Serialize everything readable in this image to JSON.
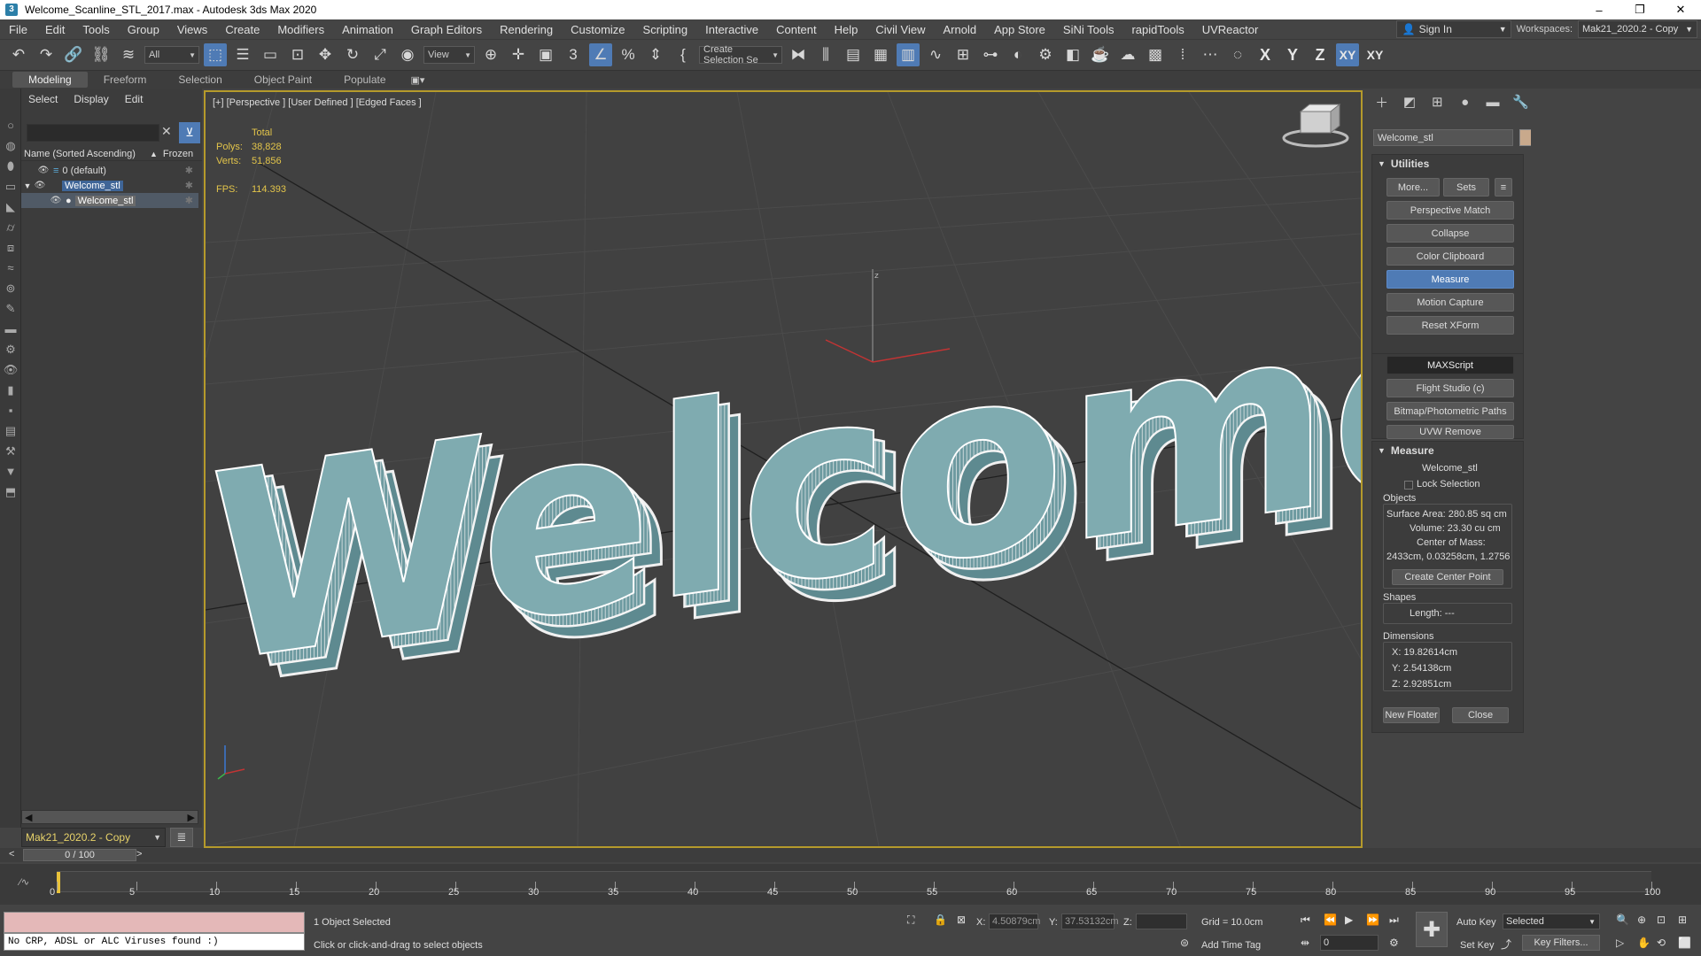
{
  "window": {
    "title": "Welcome_Scanline_STL_2017.max - Autodesk 3ds Max 2020",
    "min": "–",
    "max": "❐",
    "close": "✕"
  },
  "menu": {
    "items": [
      "File",
      "Edit",
      "Tools",
      "Group",
      "Views",
      "Create",
      "Modifiers",
      "Animation",
      "Graph Editors",
      "Rendering",
      "Customize",
      "Scripting",
      "Interactive",
      "Content",
      "Help",
      "Civil View",
      "Arnold",
      "App Store",
      "SiNi Tools",
      "rapidTools",
      "UVReactor"
    ],
    "sign_in": "Sign In",
    "workspaces_label": "Workspaces:",
    "workspace_value": "Mak21_2020.2 - Copy"
  },
  "toolbar": {
    "filter_value": "All",
    "refcoord_value": "View",
    "selection_set_value": "Create Selection Se",
    "axis_x": "X",
    "axis_y": "Y",
    "axis_z": "Z",
    "axis_xy": "XY",
    "axis_xy2": "XY"
  },
  "ribbon": {
    "tabs": [
      "Modeling",
      "Freeform",
      "Selection",
      "Object Paint",
      "Populate"
    ]
  },
  "explorer": {
    "tabs": [
      "Select",
      "Display",
      "Edit"
    ],
    "col_name": "Name (Sorted Ascending)",
    "col_frozen": "Frozen",
    "rows": [
      {
        "label": "0 (default)",
        "sel": false
      },
      {
        "label": "Welcome_stl",
        "sel": true
      },
      {
        "label": "Welcome_stl",
        "sel": true
      }
    ],
    "workspace": "Mak21_2020.2 - Copy"
  },
  "viewport": {
    "label": "[+] [Perspective ] [User Defined ] [Edged Faces ]",
    "stats_total": "Total",
    "polys_label": "Polys:",
    "polys_value": "38,828",
    "verts_label": "Verts:",
    "verts_value": "51,856",
    "fps_label": "FPS:",
    "fps_value": "114.393",
    "text3d": "Welcome",
    "axis_z": "z"
  },
  "command_panel": {
    "object_name": "Welcome_stl",
    "utilities": {
      "title": "Utilities",
      "more": "More...",
      "sets": "Sets",
      "buttons": [
        "Perspective Match",
        "Collapse",
        "Color Clipboard",
        "Measure",
        "Motion Capture",
        "Reset XForm",
        "MAXScript",
        "Flight Studio (c)",
        "Bitmap/Photometric Paths",
        "UVW Remove"
      ],
      "selected": "Measure"
    },
    "measure": {
      "title": "Measure",
      "object": "Welcome_stl",
      "lock_selection": "Lock Selection",
      "objects_label": "Objects",
      "surface_area": "Surface Area:  280.85 sq cm",
      "volume": "Volume:  23.30 cu cm",
      "center_label": "Center of Mass:",
      "center_value": "2433cm, 0.03258cm, 1.2756",
      "create_center": "Create Center Point",
      "shapes_label": "Shapes",
      "length": "Length: ---",
      "dimensions_label": "Dimensions",
      "dim_x": "X:  19.82614cm",
      "dim_y": "Y:  2.54138cm",
      "dim_z": "Z:  2.92851cm",
      "new_floater": "New Floater",
      "close": "Close"
    }
  },
  "timeline": {
    "frame": "0 / 100",
    "ticks": [
      "0",
      "5",
      "10",
      "15",
      "20",
      "25",
      "30",
      "35",
      "40",
      "45",
      "50",
      "55",
      "60",
      "65",
      "70",
      "75",
      "80",
      "85",
      "90",
      "95",
      "100"
    ]
  },
  "status": {
    "maxscript_output": "No CRP, ADSL or ALC Viruses found :)",
    "selected_msg": "1 Object Selected",
    "prompt_msg": "Click or click-and-drag to select objects",
    "x_label": "X:",
    "x_value": "4.50879cm",
    "y_label": "Y:",
    "y_value": "37.53132cm",
    "z_label": "Z:",
    "z_value": "",
    "grid": "Grid = 10.0cm",
    "add_time_tag": "Add Time Tag",
    "auto_key": "Auto Key",
    "selected_dd": "Selected",
    "set_key": "Set Key",
    "key_filters": "Key Filters...",
    "frame_field": "0"
  },
  "colors": {
    "accent": "#4f7bb5",
    "viewport_border": "#b59a2b",
    "mesh_fill": "#7fabb0",
    "stats_text": "#e3c54a"
  }
}
